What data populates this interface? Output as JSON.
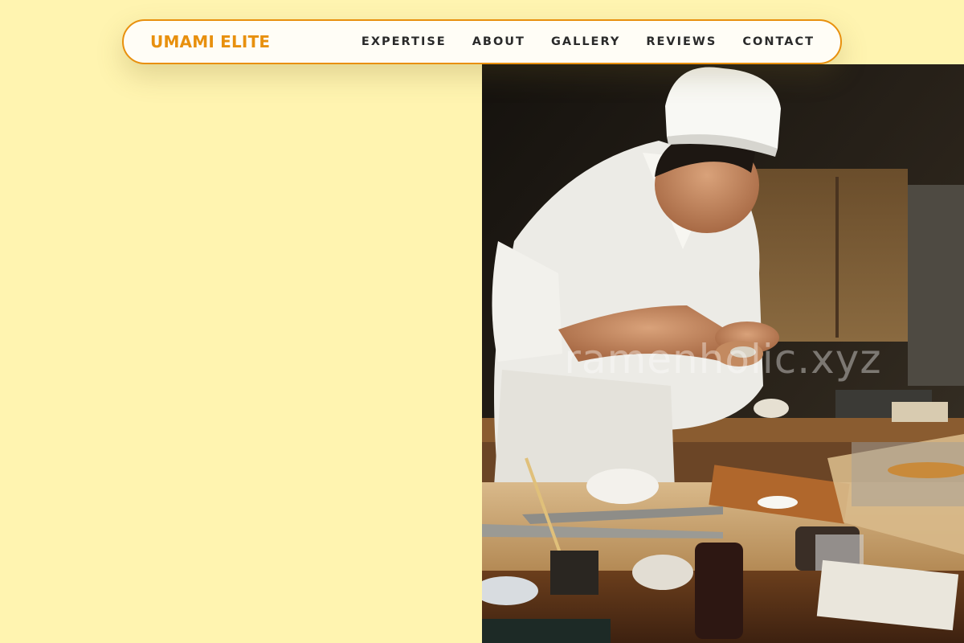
{
  "brand": {
    "name": "UMAMI ELITE",
    "color": "#e8900e"
  },
  "nav": {
    "links": [
      {
        "label": "EXPERTISE"
      },
      {
        "label": "ABOUT"
      },
      {
        "label": "GALLERY"
      },
      {
        "label": "REVIEWS"
      },
      {
        "label": "CONTACT"
      }
    ]
  },
  "hero": {
    "image_description": "sushi-chef-preparing-nigiri",
    "watermark": "ramenholic.xyz"
  },
  "colors": {
    "page_background": "#fff4b0",
    "accent": "#e8900e",
    "nav_text": "#2a2a2a"
  }
}
